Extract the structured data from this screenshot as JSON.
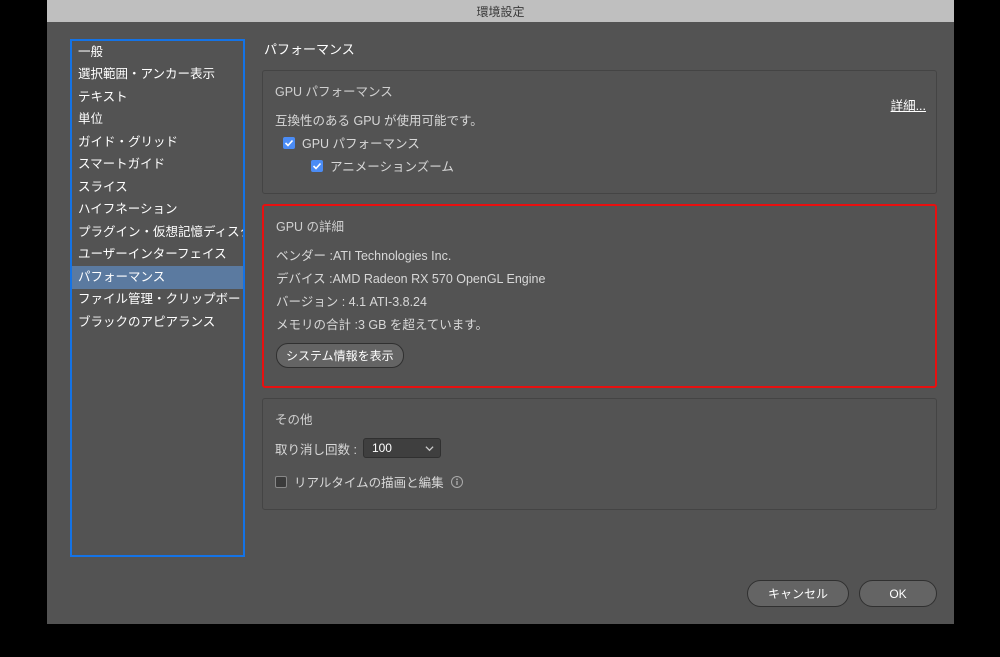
{
  "window": {
    "title": "環境設定"
  },
  "sidebar": {
    "items": [
      "一般",
      "選択範囲・アンカー表示",
      "テキスト",
      "単位",
      "ガイド・グリッド",
      "スマートガイド",
      "スライス",
      "ハイフネーション",
      "プラグイン・仮想記憶ディスク",
      "ユーザーインターフェイス",
      "パフォーマンス",
      "ファイル管理・クリップボード",
      "ブラックのアピアランス"
    ],
    "selected_index": 10
  },
  "main": {
    "page_title": "パフォーマンス",
    "gpu_perf": {
      "title": "GPU パフォーマンス",
      "compat_text": "互換性のある GPU が使用可能です。",
      "details_link": "詳細...",
      "gpu_perf_checkbox": {
        "checked": true,
        "label": "GPU パフォーマンス"
      },
      "anim_zoom_checkbox": {
        "checked": true,
        "label": "アニメーションズーム"
      }
    },
    "gpu_details": {
      "title": "GPU の詳細",
      "vendor": "ベンダー :ATI Technologies Inc.",
      "device": "デバイス :AMD Radeon RX 570 OpenGL Engine",
      "version": "バージョン : 4.1 ATI-3.8.24",
      "memory": "メモリの合計 :3 GB を超えています。",
      "sysinfo_button": "システム情報を表示"
    },
    "other": {
      "title": "その他",
      "undo_label": "取り消し回数 :",
      "undo_value": "100",
      "realtime_checkbox": {
        "checked": false,
        "label": "リアルタイムの描画と編集"
      }
    }
  },
  "footer": {
    "cancel": "キャンセル",
    "ok": "OK"
  }
}
